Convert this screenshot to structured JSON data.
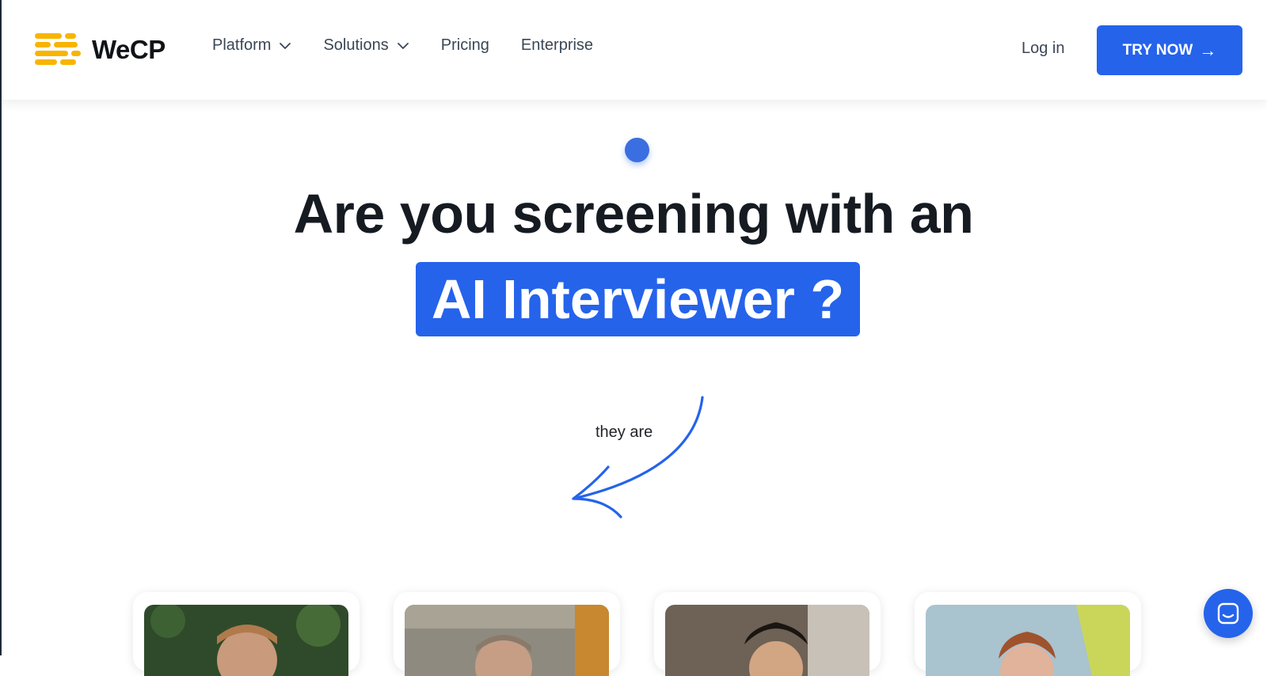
{
  "brand": {
    "name": "WeCP",
    "logo_color": "#f7b500"
  },
  "nav": {
    "items": [
      {
        "label": "Platform",
        "has_dropdown": true
      },
      {
        "label": "Solutions",
        "has_dropdown": true
      },
      {
        "label": "Pricing",
        "has_dropdown": false
      },
      {
        "label": "Enterprise",
        "has_dropdown": false
      }
    ],
    "login_label": "Log in",
    "cta_label": "TRY NOW",
    "cta_icon": "arrow-right-icon"
  },
  "hero": {
    "headline_line1": "Are you screening with an",
    "headline_highlight": "AI Interviewer ?",
    "annotation": "they are"
  },
  "cards": [
    {
      "name": "person-card-1"
    },
    {
      "name": "person-card-2"
    },
    {
      "name": "person-card-3"
    },
    {
      "name": "person-card-4"
    }
  ],
  "chat": {
    "icon": "chat-icon"
  },
  "colors": {
    "accent": "#2563eb",
    "text": "#161b22",
    "nav_text": "#3b4656"
  }
}
